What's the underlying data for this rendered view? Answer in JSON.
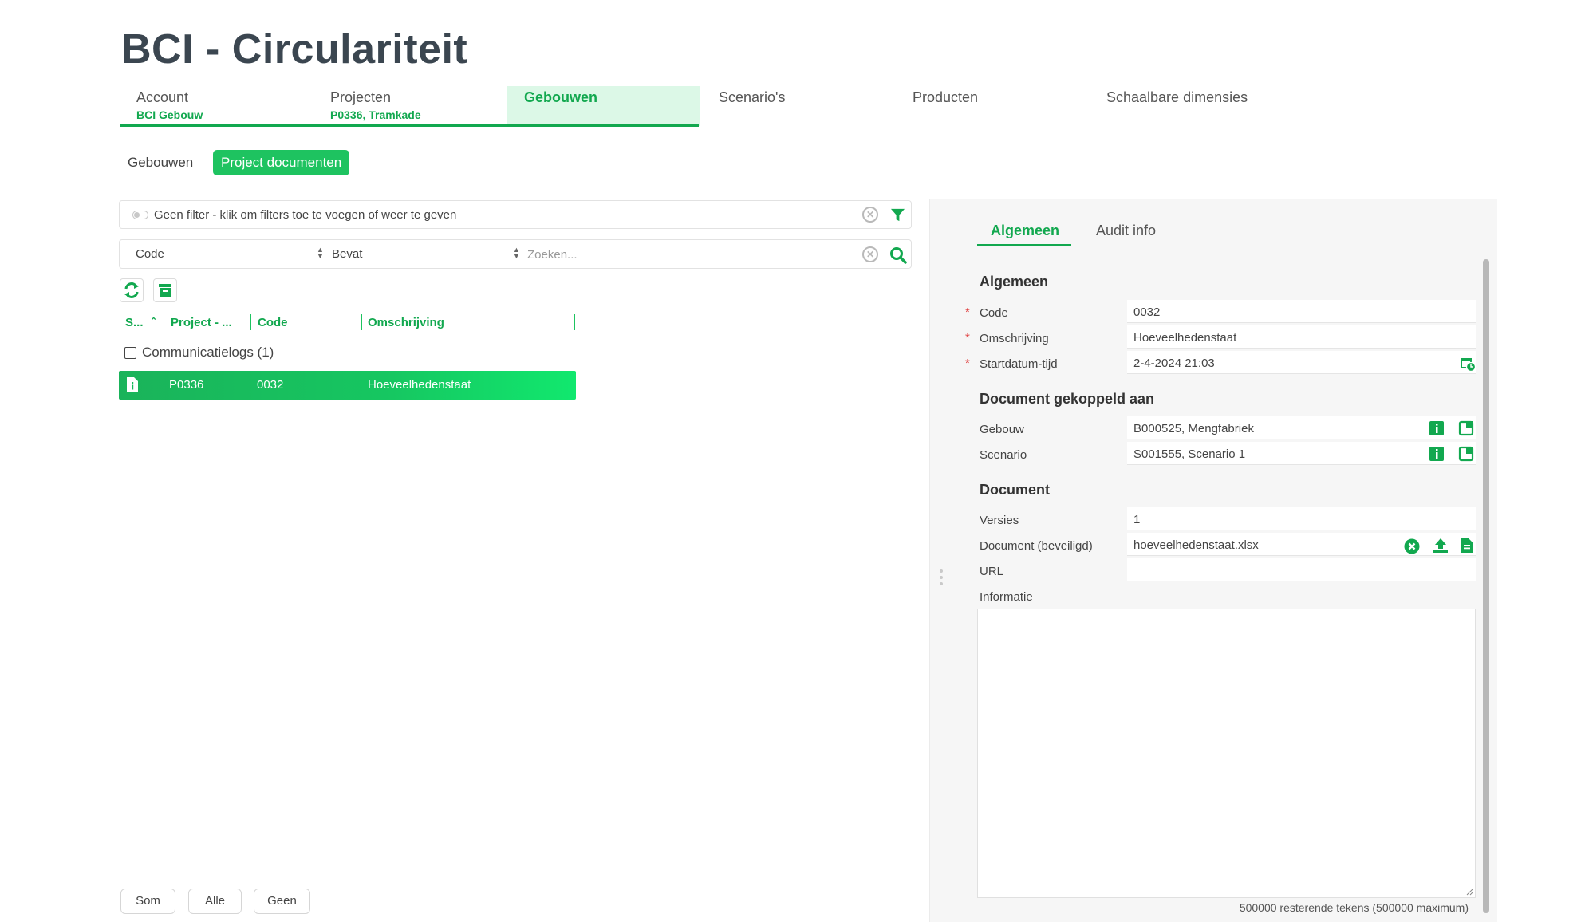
{
  "app": {
    "title": "BCI - Circulariteit"
  },
  "top_tabs": [
    {
      "label": "Account",
      "sub": "BCI Gebouw"
    },
    {
      "label": "Projecten",
      "sub": "P0336, Tramkade"
    },
    {
      "label": "Gebouwen",
      "sub": ""
    },
    {
      "label": "Scenario's",
      "sub": ""
    },
    {
      "label": "Producten",
      "sub": ""
    },
    {
      "label": "Schaalbare dimensies",
      "sub": ""
    }
  ],
  "active_top_tab": "Gebouwen",
  "sub_tabs": [
    "Gebouwen",
    "Project documenten"
  ],
  "active_sub_tab": "Project documenten",
  "filter": {
    "text": "Geen filter - klik om filters toe te voegen of weer te geven"
  },
  "search": {
    "field": "Code",
    "operator": "Bevat",
    "placeholder": "Zoeken..."
  },
  "grid": {
    "columns": [
      "S...",
      "Project - ...",
      "Code",
      "Omschrijving"
    ],
    "group": {
      "label": "Communicatielogs (1)"
    },
    "rows": [
      {
        "project": "P0336",
        "code": "0032",
        "omschrijving": "Hoeveelhedenstaat"
      }
    ]
  },
  "footer_buttons": [
    "Som",
    "Alle",
    "Geen"
  ],
  "detail": {
    "tabs": [
      "Algemeen",
      "Audit info"
    ],
    "active_tab": "Algemeen",
    "sections": {
      "algemeen": "Algemeen",
      "gekoppeld": "Document gekoppeld aan",
      "document": "Document"
    },
    "fields": {
      "code": {
        "label": "Code",
        "value": "0032"
      },
      "omschrijving": {
        "label": "Omschrijving",
        "value": "Hoeveelhedenstaat"
      },
      "startdatum": {
        "label": "Startdatum-tijd",
        "value": "2-4-2024 21:03"
      },
      "gebouw": {
        "label": "Gebouw",
        "value": "B000525, Mengfabriek"
      },
      "scenario": {
        "label": "Scenario",
        "value": "S001555, Scenario 1"
      },
      "versies": {
        "label": "Versies",
        "value": "1"
      },
      "document": {
        "label": "Document (beveiligd)",
        "value": "hoeveelhedenstaat.xlsx"
      },
      "url": {
        "label": "URL",
        "value": ""
      },
      "informatie": {
        "label": "Informatie",
        "value": ""
      }
    },
    "required_marker": "*",
    "remaining_chars": "500000 resterende tekens (500000 maximum)"
  },
  "colors": {
    "accent": "#12a84f",
    "accent_light": "#dcf8e7",
    "row_highlight": "#16c761",
    "required": "#e04040"
  }
}
